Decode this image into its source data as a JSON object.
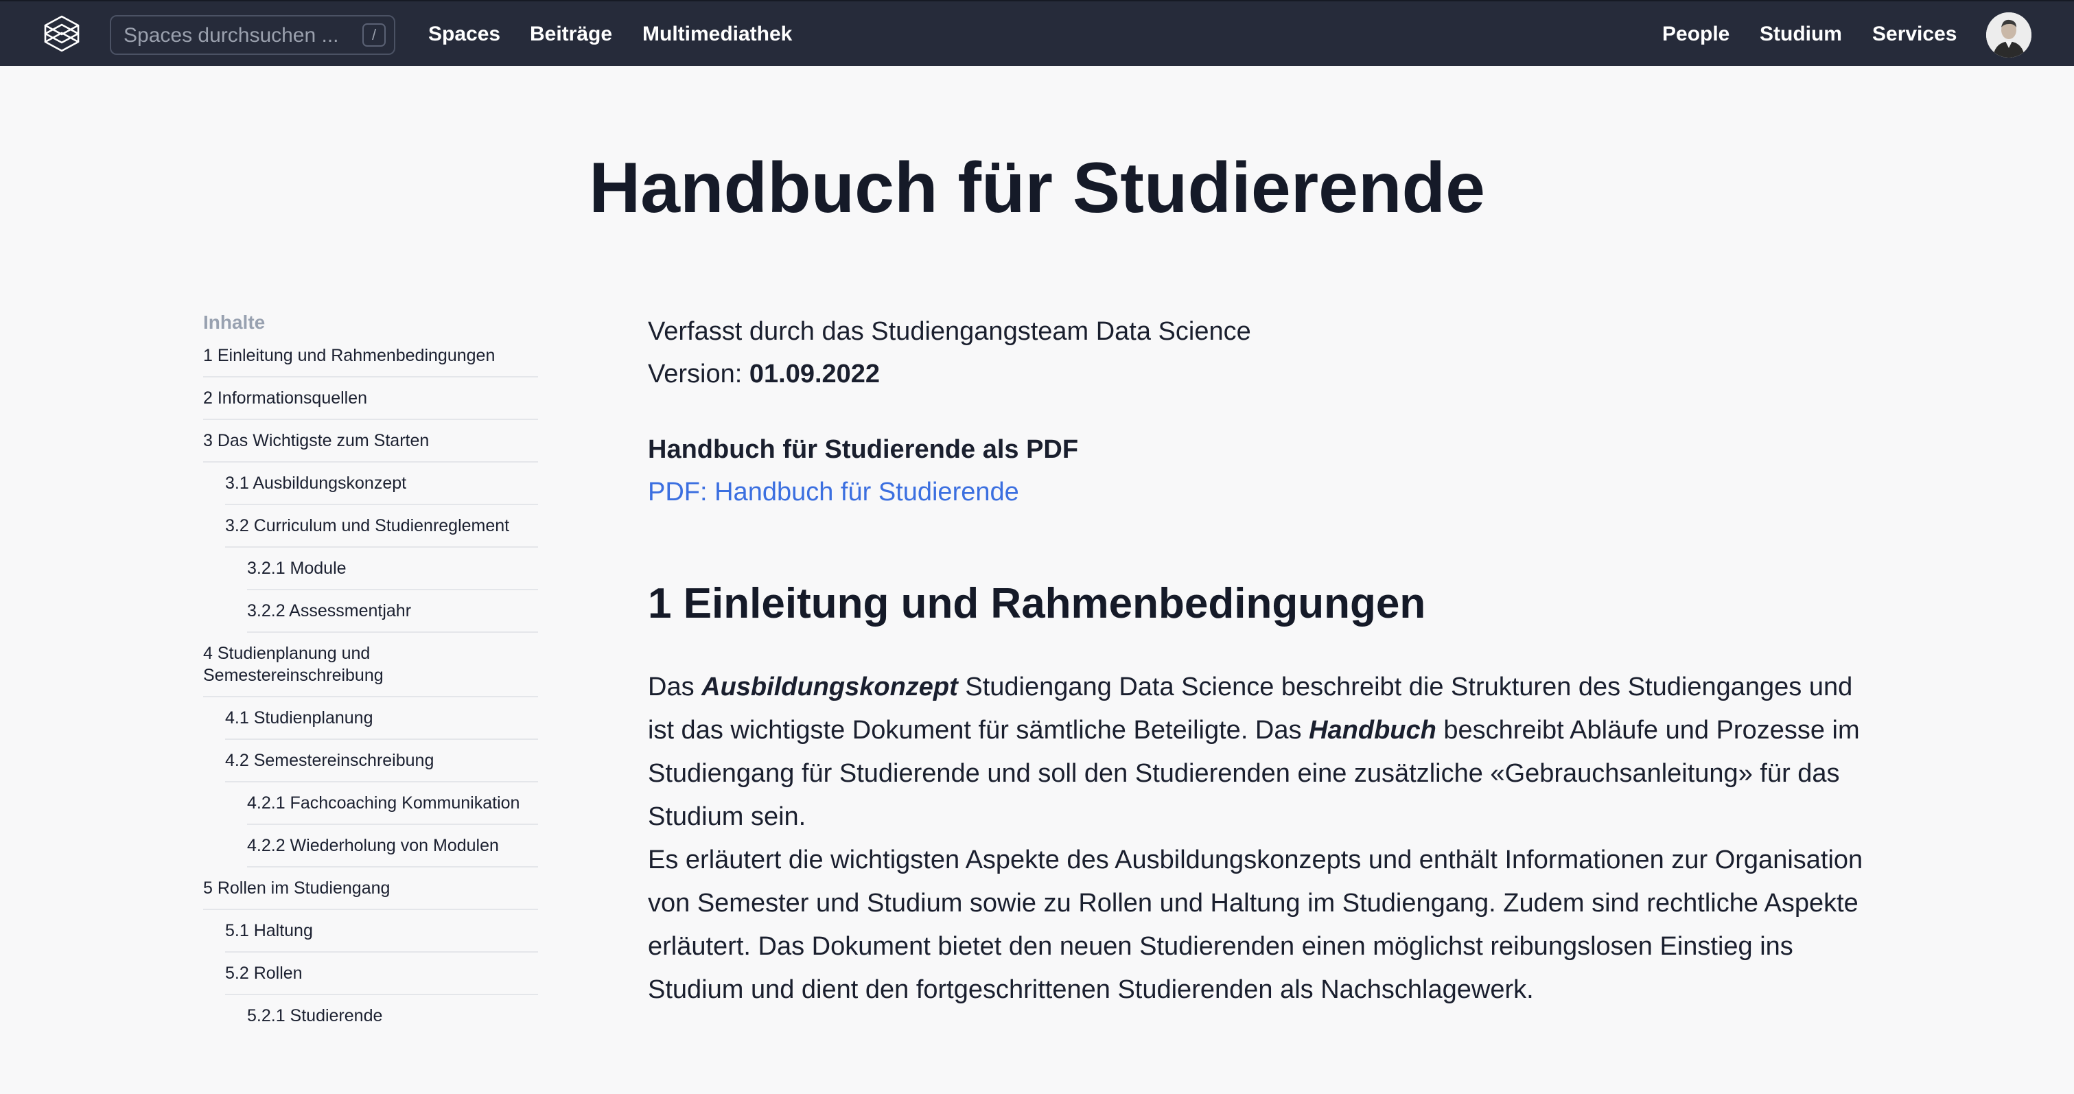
{
  "header": {
    "search_placeholder": "Spaces durchsuchen ...",
    "search_shortcut": "/",
    "nav_left": [
      "Spaces",
      "Beiträge",
      "Multimediathek"
    ],
    "nav_right": [
      "People",
      "Studium",
      "Services"
    ]
  },
  "page": {
    "title": "Handbuch für Studierende"
  },
  "toc": {
    "heading": "Inhalte",
    "items": [
      "1 Einleitung und Rahmenbedingungen",
      "2 Informationsquellen",
      "3 Das Wichtigste zum Starten",
      "3.1 Ausbildungskonzept",
      "3.2 Curriculum und Studienreglement",
      "3.2.1 Module",
      "3.2.2 Assessmentjahr",
      "4 Studienplanung und Semestereinschreibung",
      "4.1 Studienplanung",
      "4.2 Semestereinschreibung",
      "4.2.1 Fachcoaching Kommunikation",
      "4.2.2 Wiederholung von Modulen",
      "5 Rollen im Studiengang",
      "5.1 Haltung",
      "5.2 Rollen",
      "5.2.1 Studierende"
    ]
  },
  "content": {
    "author_line": "Verfasst durch das Studiengangsteam Data Science",
    "version_label": "Version: ",
    "version_value": "01.09.2022",
    "pdf_heading": "Handbuch für Studierende als PDF",
    "pdf_link": "PDF: Handbuch für Studierende",
    "section_title": "1 Einleitung und Rahmenbedingungen",
    "para1_part1": "Das ",
    "para1_em1": "Ausbildungskonzept",
    "para1_part2": " Studiengang Data Science beschreibt die Strukturen des Studienganges und ist das wichtigste Dokument für sämtliche Beteiligte. Das ",
    "para1_em2": "Handbuch",
    "para1_part3": " beschreibt Abläufe und Prozesse im Studiengang für Studierende und soll den Studierenden eine zusätzliche «Gebrauchsanleitung» für das Studium sein.",
    "para2": "Es erläutert die wichtigsten Aspekte des Ausbildungskonzepts und enthält Informationen zur Organisa­tion von Semester und Studium sowie zu Rollen und Haltung im Studiengang. Zudem sind rechtliche As­pekte erläutert. Das Dokument bietet den neuen Studierenden einen möglichst reibungslosen Einstieg ins Studium und dient den fortgeschrittenen Studierenden als Nachschlagewerk."
  }
}
